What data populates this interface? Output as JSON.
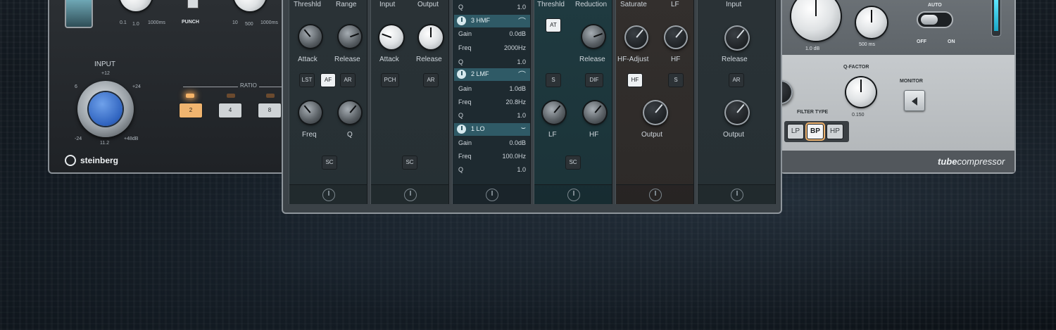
{
  "left_panel": {
    "input_label": "INPUT",
    "input_marks": [
      "+12",
      "6",
      "+24",
      "-24",
      "11.2",
      "+48dB"
    ],
    "top_marks": [
      "0.1",
      "1.0",
      "1000ms",
      "10",
      "500",
      "1000ms"
    ],
    "punch_label": "PUNCH",
    "ratio_label": "RATIO",
    "ratio_buttons": [
      "2",
      "4",
      "8"
    ],
    "brand": "steinberg"
  },
  "strip": {
    "gate": {
      "labels": [
        "Threshld",
        "Range",
        "Attack",
        "Release",
        "Freq",
        "Q"
      ],
      "buttons": [
        "LST",
        "AF",
        "AR",
        "SC"
      ]
    },
    "comp": {
      "labels": [
        "Input",
        "Output",
        "Attack",
        "Release"
      ],
      "buttons": [
        "PCH",
        "AR",
        "SC"
      ]
    },
    "eq": {
      "top": [
        {
          "k": "Q",
          "v": "1.0"
        }
      ],
      "bands": [
        {
          "name": "3 HMF",
          "rows": [
            {
              "k": "Gain",
              "v": "0.0dB"
            },
            {
              "k": "Freq",
              "v": "2000Hz"
            },
            {
              "k": "Q",
              "v": "1.0"
            }
          ]
        },
        {
          "name": "2 LMF",
          "rows": [
            {
              "k": "Gain",
              "v": "1.0dB"
            },
            {
              "k": "Freq",
              "v": "20.8Hz"
            },
            {
              "k": "Q",
              "v": "1.0"
            }
          ]
        },
        {
          "name": "1 LO",
          "rows": [
            {
              "k": "Gain",
              "v": "0.0dB"
            },
            {
              "k": "Freq",
              "v": "100.0Hz"
            },
            {
              "k": "Q",
              "v": "1.0"
            }
          ]
        }
      ]
    },
    "deesser": {
      "labels": [
        "Threshld",
        "Reduction",
        "Release",
        "LF",
        "HF"
      ],
      "buttons": [
        "AT",
        "S",
        "DIF",
        "SC"
      ]
    },
    "saturator": {
      "labels": [
        "Saturate",
        "LF",
        "HF-Adjust",
        "HF",
        "Output"
      ],
      "buttons": [
        "HF",
        "S"
      ]
    },
    "limiter": {
      "labels": [
        "Input",
        "Release",
        "Output"
      ],
      "buttons": [
        "AR"
      ]
    }
  },
  "tube": {
    "labels": {
      "drive_value": "1.0 dB",
      "time_value": "500 ms",
      "auto": "AUTO",
      "off": "OFF",
      "on": "ON",
      "qfactor": "Q-FACTOR",
      "qvalue": "0.150",
      "monitor": "MONITOR",
      "filter_type": "FILTER TYPE",
      "brand_bold": "tube",
      "brand_rest": "compressor"
    },
    "filter_buttons": [
      "LP",
      "BP",
      "HP"
    ]
  },
  "colors": {
    "accent_orange": "#f0a85a",
    "eq_band": "#2f5a66",
    "teal_module": "#1f3a40",
    "meter_cyan": "#27c6e6"
  }
}
